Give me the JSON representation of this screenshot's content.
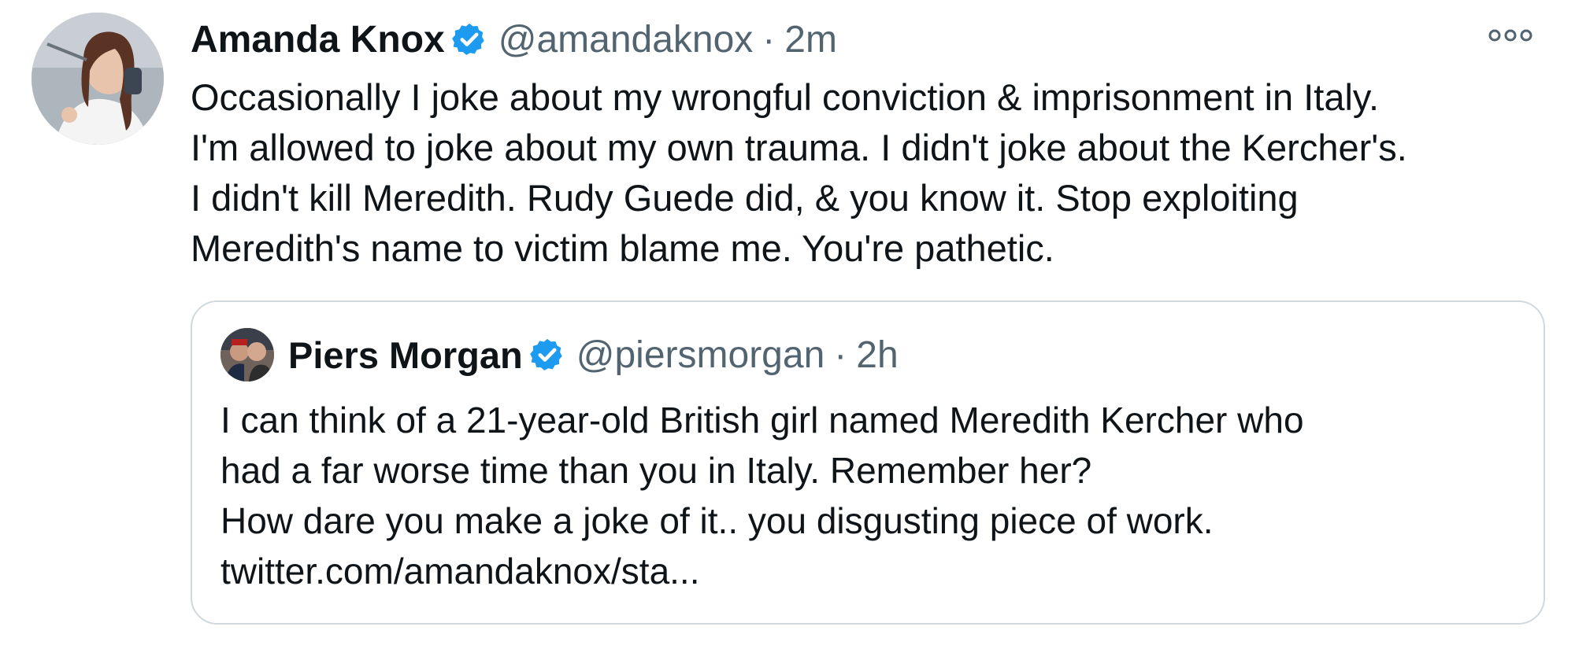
{
  "tweet": {
    "author_name": "Amanda Knox",
    "handle": "@amandaknox",
    "separator": "·",
    "time": "2m",
    "text_lines": [
      "Occasionally I joke about my wrongful conviction & imprisonment in Italy.",
      "I'm allowed to joke about my own trauma. I didn't joke about the Kercher's.",
      "I didn't kill Meredith. Rudy Guede did, & you know it. Stop exploiting",
      "Meredith's name to victim blame me. You're pathetic."
    ]
  },
  "quoted_tweet": {
    "author_name": "Piers Morgan",
    "handle": "@piersmorgan",
    "separator": "·",
    "time": "2h",
    "text_lines": [
      "I can think of a 21-year-old British girl named Meredith Kercher who",
      "had a far worse time than you in Italy. Remember her?",
      "How dare you make a joke of it.. you disgusting piece of work.",
      "twitter.com/amandaknox/sta..."
    ]
  },
  "icons": {
    "verified": "verified-badge-icon",
    "more": "more-options-icon"
  },
  "colors": {
    "verified_blue": "#1d9bf0",
    "text": "#0f1419",
    "muted": "#536471",
    "border": "#cfd9de"
  }
}
